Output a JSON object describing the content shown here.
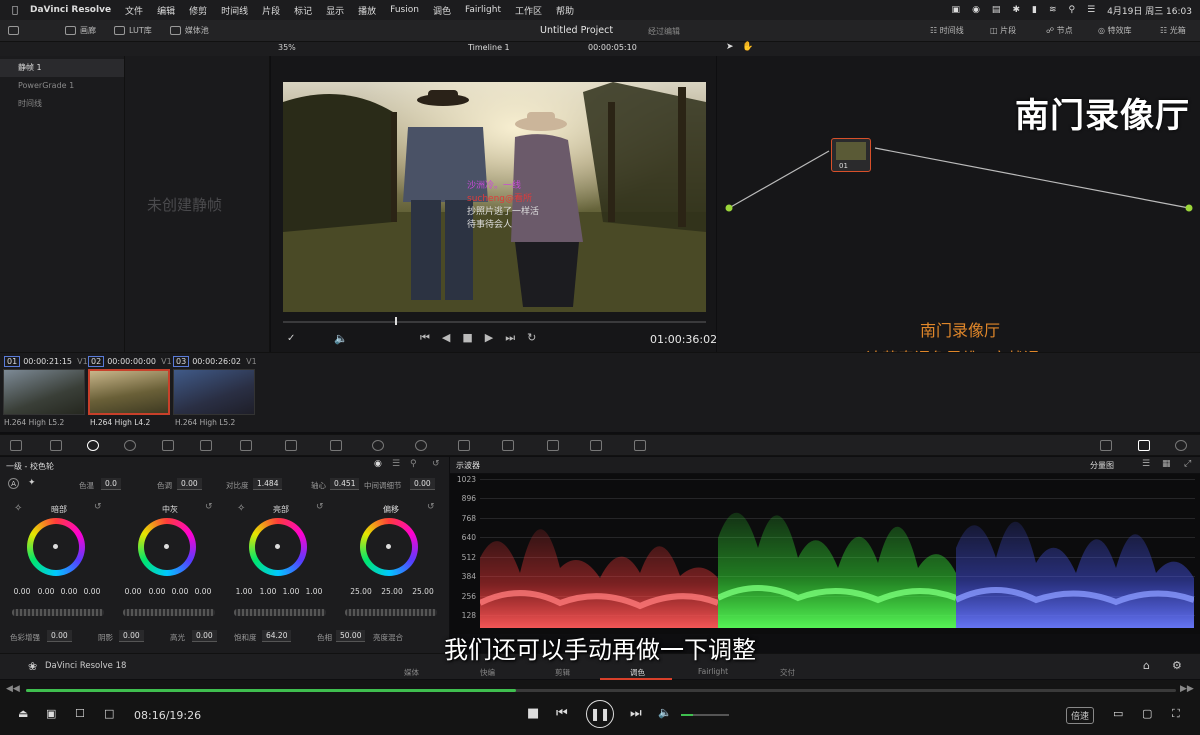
{
  "menubar": {
    "apple": "",
    "app_name": "DaVinci Resolve",
    "items": [
      "文件",
      "编辑",
      "修剪",
      "时间线",
      "片段",
      "标记",
      "显示",
      "播放",
      "Fusion",
      "调色",
      "Fairlight",
      "工作区",
      "帮助"
    ],
    "datetime": "4月19日 周三 16:03"
  },
  "header": {
    "gallery_tab": "画廊",
    "lut_tab": "LUT库",
    "media_tab": "媒体池",
    "project_title": "Untitled Project",
    "project_status": "经过编辑",
    "right_tabs": [
      "时间线",
      "片段",
      "节点",
      "特效库",
      "光箱"
    ]
  },
  "viewer": {
    "zoom": "35%",
    "timeline_name": "Timeline 1",
    "source_tc": "00:00:05:10",
    "record_tc": "01:00:36:02",
    "frame_text": [
      "沙洲冷。一线",
      "sucheng@看所",
      "抄照片逃了一样活",
      "待事待会人"
    ]
  },
  "left_panel": {
    "items": [
      "静帧 1",
      "PowerGrade 1",
      "时间线"
    ],
    "empty_text": "未创建静帧"
  },
  "node": {
    "label": "01"
  },
  "watermark": {
    "big": "南门录像厅",
    "line1": "南门录像厅",
    "line2": "达芬奇调色思维+实战课"
  },
  "clips": [
    {
      "num": "01",
      "tc": "00:00:21:15",
      "track": "V1",
      "codec": "H.264 High L5.2"
    },
    {
      "num": "02",
      "tc": "00:00:00:00",
      "track": "V1",
      "codec": "H.264 High L4.2"
    },
    {
      "num": "03",
      "tc": "00:00:26:02",
      "track": "V1",
      "codec": "H.264 High L5.2"
    }
  ],
  "primaries": {
    "title": "一级 - 校色轮",
    "temp_label": "色温",
    "temp": "0.0",
    "tint_label": "色调",
    "tint": "0.00",
    "contrast_label": "对比度",
    "contrast": "1.484",
    "pivot_label": "轴心",
    "pivot": "0.451",
    "middetail_label": "中间调细节",
    "middetail": "0.00",
    "wheels": [
      {
        "name": "暗部",
        "values": [
          "0.00",
          "0.00",
          "0.00",
          "0.00"
        ]
      },
      {
        "name": "中灰",
        "values": [
          "0.00",
          "0.00",
          "0.00",
          "0.00"
        ]
      },
      {
        "name": "亮部",
        "values": [
          "1.00",
          "1.00",
          "1.00",
          "1.00"
        ]
      },
      {
        "name": "偏移",
        "values": [
          "25.00",
          "25.00",
          "25.00"
        ]
      }
    ],
    "colorboost_label": "色彩增强",
    "colorboost": "0.00",
    "shadow_label": "阴影",
    "shadow": "0.00",
    "highlight_label": "高光",
    "highlight": "0.00",
    "sat_label": "饱和度",
    "sat": "64.20",
    "hue_label": "色相",
    "hue": "50.00",
    "lummix_label": "亮度混合"
  },
  "scope": {
    "title": "示波器",
    "mode": "分量图",
    "ticks": [
      "1023",
      "896",
      "768",
      "640",
      "512",
      "384",
      "256",
      "128"
    ],
    "colors": {
      "red": "#ff3a3a",
      "green": "#3aff3a",
      "blue": "#4a5aff"
    }
  },
  "bottom": {
    "brand": "DaVinci Resolve 18",
    "pages": [
      "媒体",
      "快编",
      "剪辑",
      "调色",
      "Fairlight",
      "交付"
    ],
    "active_page": "调色"
  },
  "subtitle": "我们还可以手动再做一下调整",
  "player": {
    "time": "08:16/19:26",
    "progress": 0.426,
    "speed_label": "倍速",
    "accent": "#3fbf4f"
  }
}
